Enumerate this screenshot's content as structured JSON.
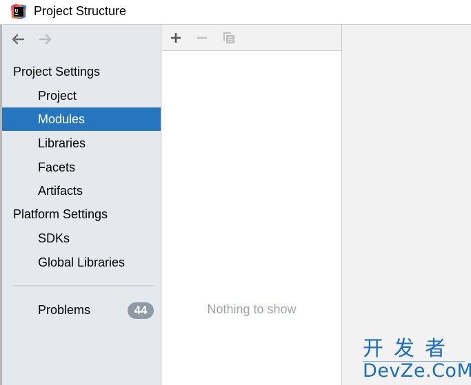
{
  "window": {
    "title": "Project Structure",
    "app_icon": "intellij-idea-icon"
  },
  "sidebar": {
    "nav": {
      "back_icon": "arrow-left-icon",
      "forward_icon": "arrow-right-icon",
      "forward_enabled": false
    },
    "sections": [
      {
        "header": "Project Settings",
        "items": [
          {
            "label": "Project",
            "selected": false
          },
          {
            "label": "Modules",
            "selected": true
          },
          {
            "label": "Libraries",
            "selected": false
          },
          {
            "label": "Facets",
            "selected": false
          },
          {
            "label": "Artifacts",
            "selected": false
          }
        ]
      },
      {
        "header": "Platform Settings",
        "items": [
          {
            "label": "SDKs",
            "selected": false
          },
          {
            "label": "Global Libraries",
            "selected": false
          }
        ]
      }
    ],
    "problems": {
      "label": "Problems",
      "count": "44"
    }
  },
  "middle": {
    "toolbar": {
      "add_icon": "plus-icon",
      "remove_icon": "minus-icon",
      "copy_icon": "copy-icon"
    },
    "empty_text": "Nothing to show"
  },
  "watermark": {
    "chinese": "开发者",
    "english": "DevZe.CoM"
  },
  "colors": {
    "selection": "#2675bf",
    "sidebar_bg": "#e5e9ee",
    "badge_bg": "#8e9aa6",
    "watermark": "#1a6fc1"
  }
}
